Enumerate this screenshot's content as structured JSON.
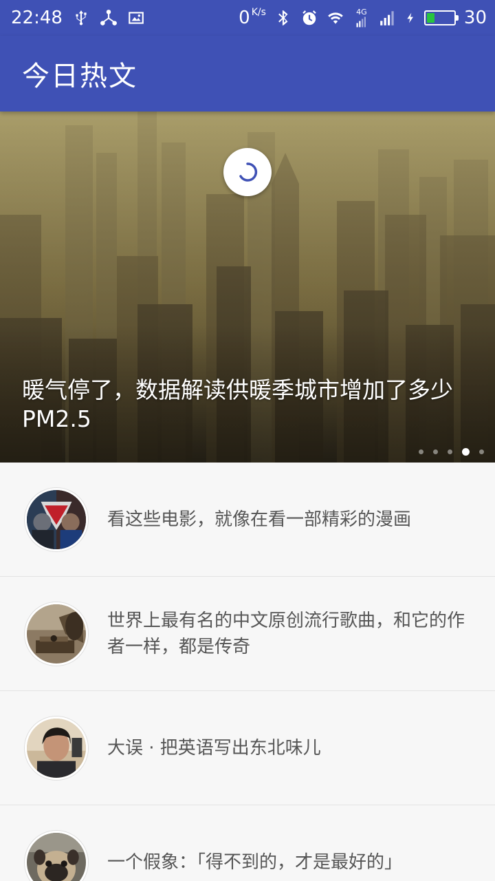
{
  "status_bar": {
    "time": "22:48",
    "net_speed": "0",
    "net_speed_unit": "K/s",
    "signal_label": "4G",
    "battery": "30",
    "battery_color": "#27c53f",
    "icons": [
      "usb-icon",
      "share-icon",
      "image-icon",
      "bluetooth-icon",
      "alarm-icon",
      "wifi-icon",
      "signal-4g-icon",
      "signal-icon",
      "charging-icon"
    ]
  },
  "app_bar": {
    "title": "今日热文",
    "color": "#3f51b5"
  },
  "banner": {
    "title": "暖气停了，数据解读供暖季城市增加了多少 PM2.5",
    "page_count": 5,
    "active_page": 4
  },
  "articles": [
    {
      "title": "看这些电影，就像在看一部精彩的漫画"
    },
    {
      "title": "世界上最有名的中文原创流行歌曲，和它的作者一样，都是传奇"
    },
    {
      "title": "大误 · 把英语写出东北味儿"
    },
    {
      "title": "一个假象：「得不到的，才是最好的」"
    }
  ]
}
